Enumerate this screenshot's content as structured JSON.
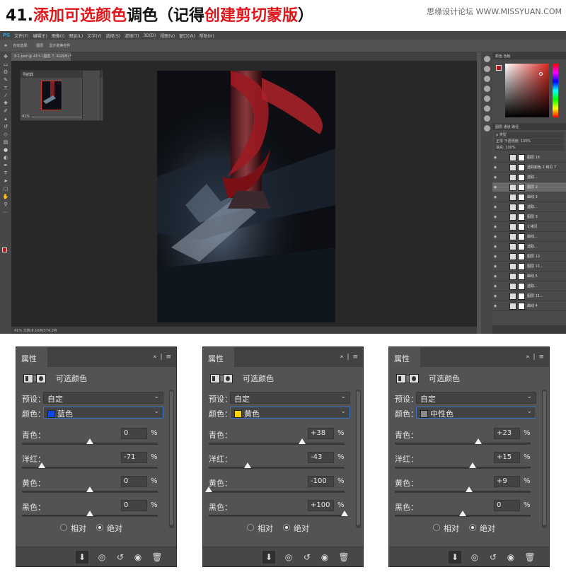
{
  "header": {
    "number": "41.",
    "part1": "添加可选颜色",
    "part2": "调色（记得",
    "part3": "创建剪切蒙版",
    "part4": "）",
    "watermark": "思缘设计论坛  WWW.MISSYUAN.COM",
    "accent_color": "#e0161b"
  },
  "photoshop": {
    "menu": [
      "PS",
      "文件(F)",
      "编辑(E)",
      "图像(I)",
      "图层(L)",
      "文字(Y)",
      "选择(S)",
      "滤镜(T)",
      "3D(D)",
      "视图(V)",
      "窗口(W)",
      "帮助(H)"
    ],
    "options_bar": [
      "自动选择：",
      "图层",
      "显示变换控件"
    ],
    "doc_tab": "8-1.psd @ 41% (图层 7, RGB/8) *",
    "status": "41%    文档:8.16M/374.2M",
    "navigator_title": "导航器",
    "navigator_zoom": "41%",
    "color_tabs": "颜色    色板",
    "layers_tabs": "图层    通道    路径",
    "layers_kind": "ρ 类型",
    "layers_blend": "正常",
    "layers_opacity": "不透明度: 100%",
    "layers_fill": "填充: 100%",
    "layers": [
      {
        "name": "图层 16",
        "selected": false
      },
      {
        "name": "选取颜色 2 拷贝 7",
        "selected": false
      },
      {
        "name": "选取...",
        "selected": false
      },
      {
        "name": "图层 2",
        "selected": true
      },
      {
        "name": "曲线 3",
        "selected": false
      },
      {
        "name": "选取...",
        "selected": false
      },
      {
        "name": "图层 3",
        "selected": false
      },
      {
        "name": "1 拷贝",
        "selected": false
      },
      {
        "name": "曲线...",
        "selected": false
      },
      {
        "name": "选取...",
        "selected": false
      },
      {
        "name": "图层 13",
        "selected": false
      },
      {
        "name": "图层 11...",
        "selected": false
      },
      {
        "name": "曲线 5",
        "selected": false
      },
      {
        "name": "选取...",
        "selected": false
      },
      {
        "name": "图层 11...",
        "selected": false
      },
      {
        "name": "曲线 4",
        "selected": false
      }
    ]
  },
  "panels": [
    {
      "tab": "属性",
      "type_label": "可选颜色",
      "preset_label": "预设：",
      "preset_value": "自定",
      "color_label": "颜色：",
      "color_value": "蓝色",
      "color_chip": "#1348e6",
      "sliders": [
        {
          "label": "青色：",
          "value": "0",
          "fraction": 0.5
        },
        {
          "label": "洋红：",
          "value": "-71",
          "fraction": 0.145
        },
        {
          "label": "黄色：",
          "value": "0",
          "fraction": 0.5
        },
        {
          "label": "黑色：",
          "value": "0",
          "fraction": 0.5
        }
      ],
      "relative": "相对",
      "absolute": "绝对",
      "selected_mode": "absolute"
    },
    {
      "tab": "属性",
      "type_label": "可选颜色",
      "preset_label": "预设：",
      "preset_value": "自定",
      "color_label": "颜色：",
      "color_value": "黄色",
      "color_chip": "#f5d20a",
      "sliders": [
        {
          "label": "青色：",
          "value": "+38",
          "fraction": 0.69
        },
        {
          "label": "洋红：",
          "value": "-43",
          "fraction": 0.285
        },
        {
          "label": "黄色：",
          "value": "-100",
          "fraction": 0.0
        },
        {
          "label": "黑色：",
          "value": "+100",
          "fraction": 1.0
        }
      ],
      "relative": "相对",
      "absolute": "绝对",
      "selected_mode": "absolute"
    },
    {
      "tab": "属性",
      "type_label": "可选颜色",
      "preset_label": "预设：",
      "preset_value": "自定",
      "color_label": "颜色：",
      "color_value": "中性色",
      "color_chip": "#8a8a8a",
      "sliders": [
        {
          "label": "青色：",
          "value": "+23",
          "fraction": 0.615
        },
        {
          "label": "洋红：",
          "value": "+15",
          "fraction": 0.575
        },
        {
          "label": "黄色：",
          "value": "+9",
          "fraction": 0.545
        },
        {
          "label": "黑色：",
          "value": "0",
          "fraction": 0.5
        }
      ],
      "relative": "相对",
      "absolute": "绝对",
      "selected_mode": "absolute"
    }
  ],
  "pct_sign": "%"
}
